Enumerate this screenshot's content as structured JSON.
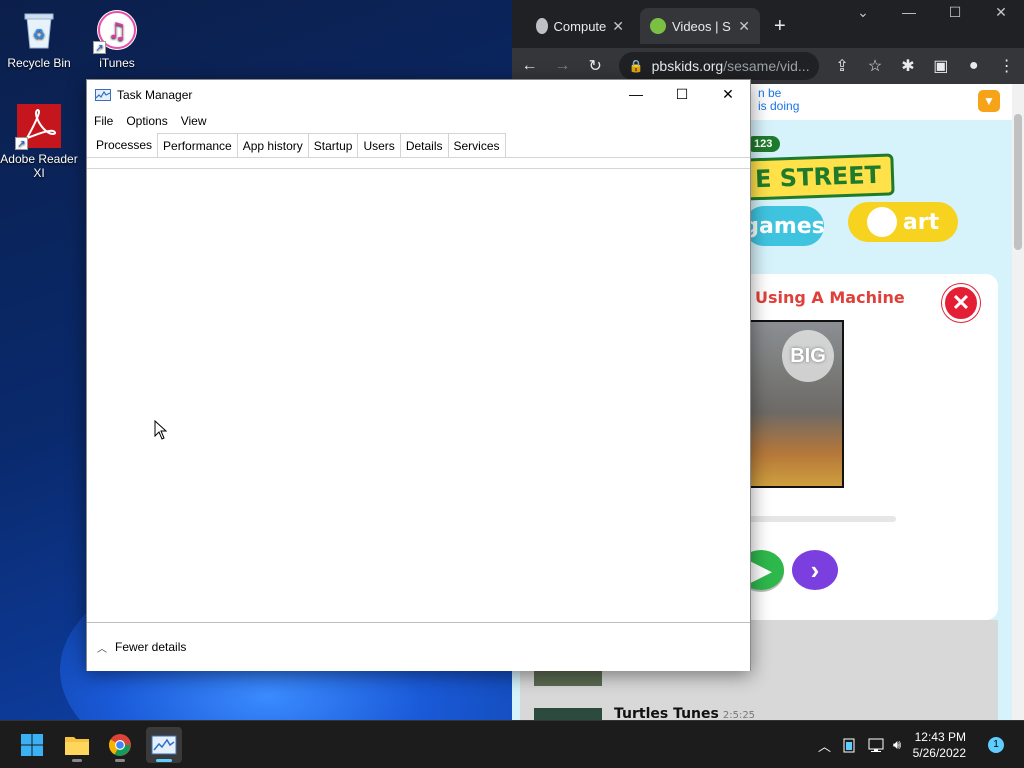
{
  "desktop": {
    "icons": [
      {
        "label": "Recycle Bin"
      },
      {
        "label": "iTunes"
      },
      {
        "label": "Adobe Reader XI"
      }
    ]
  },
  "browser": {
    "tabs": [
      {
        "label": "Compute",
        "active": false
      },
      {
        "label": "Videos | S",
        "active": true
      }
    ],
    "new_tab": "+",
    "url_host": "pbskids.org",
    "url_rest": "/sesame/vid...",
    "page": {
      "banner_text": "n be\nis doing",
      "logo_number": "123",
      "logo_text": "E STREET",
      "games_label": "games",
      "art_label": "art",
      "video_title": "Using A Machine",
      "video_badge": "BIG",
      "progress": 0,
      "list_item_title": "Turtles Tunes",
      "list_item_time": "2:5:25"
    }
  },
  "taskmanager": {
    "title": "Task Manager",
    "menu": [
      "File",
      "Options",
      "View"
    ],
    "tabs": [
      {
        "label": "Processes",
        "active": true
      },
      {
        "label": "Performance",
        "active": false
      },
      {
        "label": "App history",
        "active": false
      },
      {
        "label": "Startup",
        "active": false
      },
      {
        "label": "Users",
        "active": false
      },
      {
        "label": "Details",
        "active": false
      },
      {
        "label": "Services",
        "active": false
      }
    ],
    "footer_label": "Fewer details"
  },
  "taskbar": {
    "time": "12:43 PM",
    "date": "5/26/2022",
    "notification_count": "1"
  },
  "colors": {
    "accent": "#60cdff",
    "desktop_bg": "#0a2a6e",
    "browser_bg": "#202124"
  }
}
